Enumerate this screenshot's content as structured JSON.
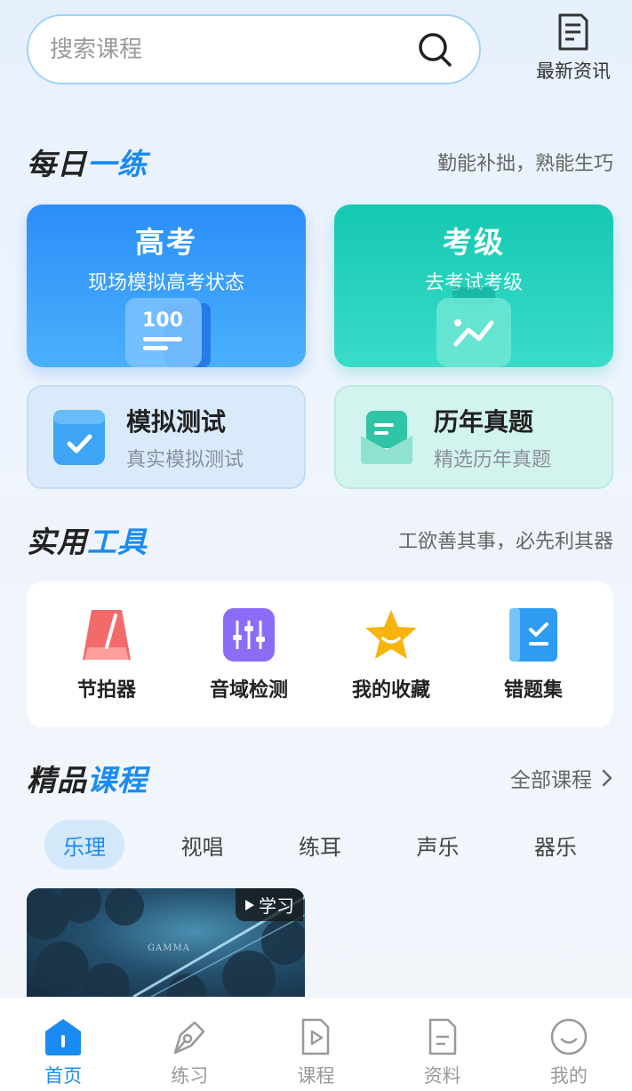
{
  "search": {
    "placeholder": "搜索课程",
    "icon": "search-icon"
  },
  "news": {
    "label": "最新资讯",
    "icon": "news-icon"
  },
  "daily": {
    "title_a": "每日",
    "title_b": "一练",
    "slogan": "勤能补拙，熟能生巧",
    "gaokao": {
      "title": "高考",
      "subtitle": "现场模拟高考状态",
      "badge": "100"
    },
    "kaoji": {
      "title": "考级",
      "subtitle": "去考试考级"
    },
    "mock": {
      "title": "模拟测试",
      "subtitle": "真实模拟测试"
    },
    "past": {
      "title": "历年真题",
      "subtitle": "精选历年真题"
    }
  },
  "tools": {
    "title_a": "实用",
    "title_b": "工具",
    "slogan": "工欲善其事，必先利其器",
    "items": [
      {
        "label": "节拍器",
        "icon": "metronome-icon"
      },
      {
        "label": "音域检测",
        "icon": "equalizer-icon"
      },
      {
        "label": "我的收藏",
        "icon": "star-icon"
      },
      {
        "label": "错题集",
        "icon": "notebook-icon"
      }
    ]
  },
  "courses": {
    "title_a": "精品",
    "title_b": "课程",
    "more": "全部课程",
    "tabs": [
      "乐理",
      "视唱",
      "练耳",
      "声乐",
      "器乐"
    ],
    "active_tab": 0,
    "card": {
      "badge": "学习",
      "art_text": "GAMMA"
    }
  },
  "nav": {
    "items": [
      {
        "label": "首页",
        "icon": "home-icon"
      },
      {
        "label": "练习",
        "icon": "pen-icon"
      },
      {
        "label": "课程",
        "icon": "play-doc-icon"
      },
      {
        "label": "资料",
        "icon": "document-icon"
      },
      {
        "label": "我的",
        "icon": "profile-icon"
      }
    ],
    "active": 0
  },
  "colors": {
    "accent": "#1a8bf2",
    "blue_card": "#2b8ef9",
    "teal_card": "#15c8b1"
  }
}
